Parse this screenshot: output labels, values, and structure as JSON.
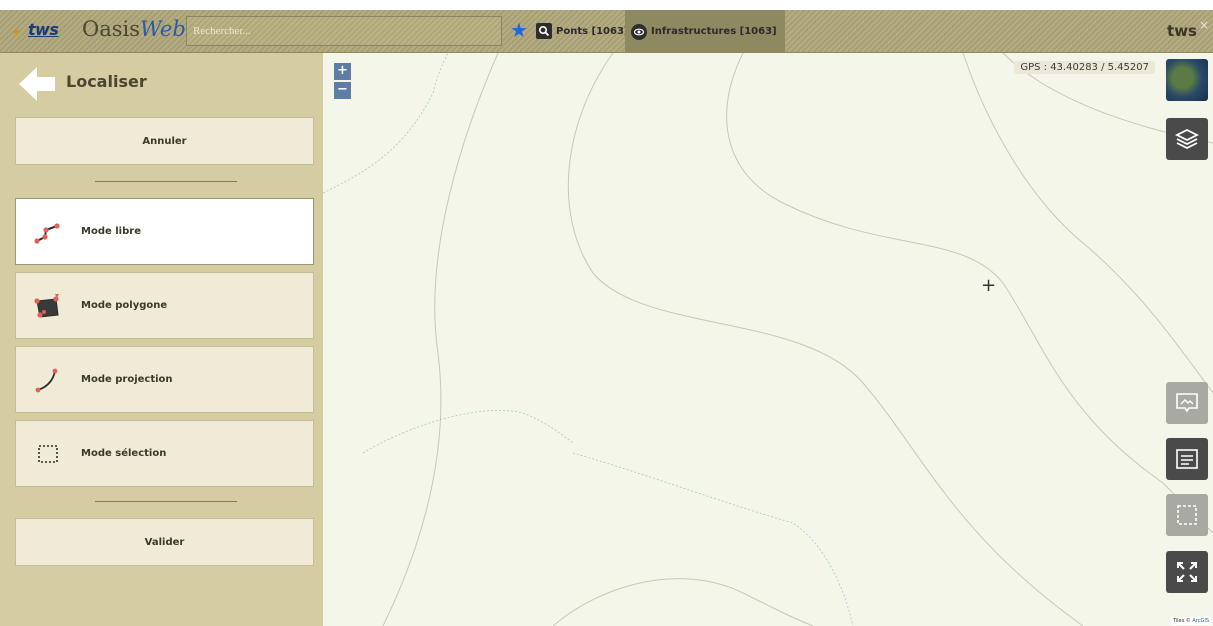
{
  "header": {
    "logo_text": "tws",
    "app_name_main": "Oasis",
    "app_name_accent": "Web",
    "search_placeholder": "Rechercher...",
    "ponts_label": "Ponts [1063]",
    "infra_label": "Infrastructures [1063]",
    "user_label": "tws",
    "close_glyph": "×"
  },
  "sidebar": {
    "title": "Localiser",
    "cancel_label": "Annuler",
    "modes": [
      {
        "label": "Mode libre",
        "icon": "freehand-line-icon",
        "active": true
      },
      {
        "label": "Mode polygone",
        "icon": "polygon-icon",
        "active": false
      },
      {
        "label": "Mode projection",
        "icon": "projection-curve-icon",
        "active": false
      },
      {
        "label": "Mode sélection",
        "icon": "dashed-selection-icon",
        "active": false
      }
    ],
    "validate_label": "Valider"
  },
  "map": {
    "zoom_in": "+",
    "zoom_out": "−",
    "gps": "GPS : 43.40283 / 5.45207",
    "crosshair": "+",
    "attribution_prefix": "Tiles © ",
    "attribution_link": "ArcGIS",
    "right_controls": [
      "satellite-basemap-icon",
      "layers-icon",
      "image-comment-icon",
      "list-icon",
      "selection-box-icon",
      "fullscreen-icon"
    ]
  },
  "colors": {
    "topbar": "#b0a97e",
    "sidebar": "#d5cca1",
    "button": "#efebd6",
    "map_bg": "#f4f6ea",
    "accent_blue": "#1e6ad8",
    "pin_red": "#e0605a"
  }
}
